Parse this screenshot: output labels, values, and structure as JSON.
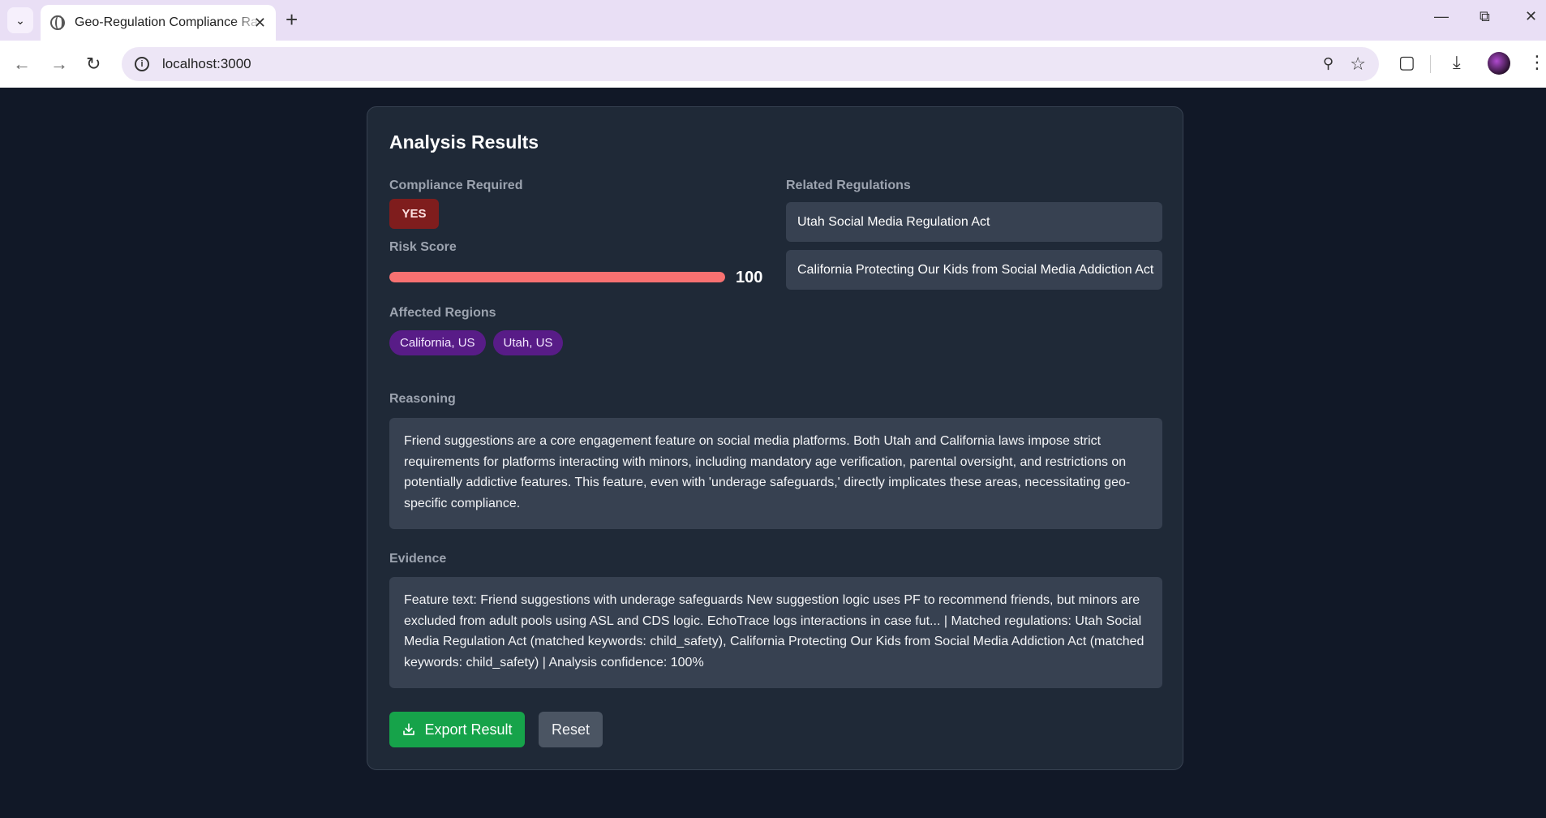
{
  "browser": {
    "tab_title": "Geo-Regulation Compliance Ra",
    "url": "localhost:3000",
    "icons": [
      "tab-search-icon",
      "globe-icon",
      "close-icon",
      "new-tab-icon",
      "minimize-icon",
      "restore-icon",
      "window-close-icon",
      "back-icon",
      "forward-icon",
      "reload-icon",
      "site-info-icon",
      "zoom-icon",
      "bookmark-star-icon",
      "extensions-icon",
      "downloads-icon",
      "profile-avatar",
      "more-menu-icon"
    ]
  },
  "results": {
    "title": "Analysis Results",
    "compliance_label": "Compliance Required",
    "compliance_value": "YES",
    "risk_label": "Risk Score",
    "risk_score": "100",
    "risk_fraction": 1.0,
    "regions_label": "Affected Regions",
    "regions": [
      "California, US",
      "Utah, US"
    ],
    "regulations_label": "Related Regulations",
    "regulations": [
      "Utah Social Media Regulation Act",
      "California Protecting Our Kids from Social Media Addiction Act"
    ],
    "reasoning_label": "Reasoning",
    "reasoning": "Friend suggestions are a core engagement feature on social media platforms. Both Utah and California laws impose strict requirements for platforms interacting with minors, including mandatory age verification, parental oversight, and restrictions on potentially addictive features. This feature, even with 'underage safeguards,' directly implicates these areas, necessitating geo-specific compliance.",
    "evidence_label": "Evidence",
    "evidence": "Feature text: Friend suggestions with underage safeguards New suggestion logic uses PF to recommend friends, but minors are excluded from adult pools using ASL and CDS logic. EchoTrace logs interactions in case fut... | Matched regulations: Utah Social Media Regulation Act (matched keywords: child_safety), California Protecting Our Kids from Social Media Addiction Act (matched keywords: child_safety) | Analysis confidence: 100%",
    "export_label": "Export Result",
    "reset_label": "Reset"
  },
  "colors": {
    "page_bg": "#111827",
    "card_bg": "#1f2937",
    "yes_badge": "#7f1d1d",
    "risk_fill": "#f87171",
    "region_chip": "#581c87",
    "export_button": "#16a34a",
    "reset_button": "#4b5563"
  }
}
